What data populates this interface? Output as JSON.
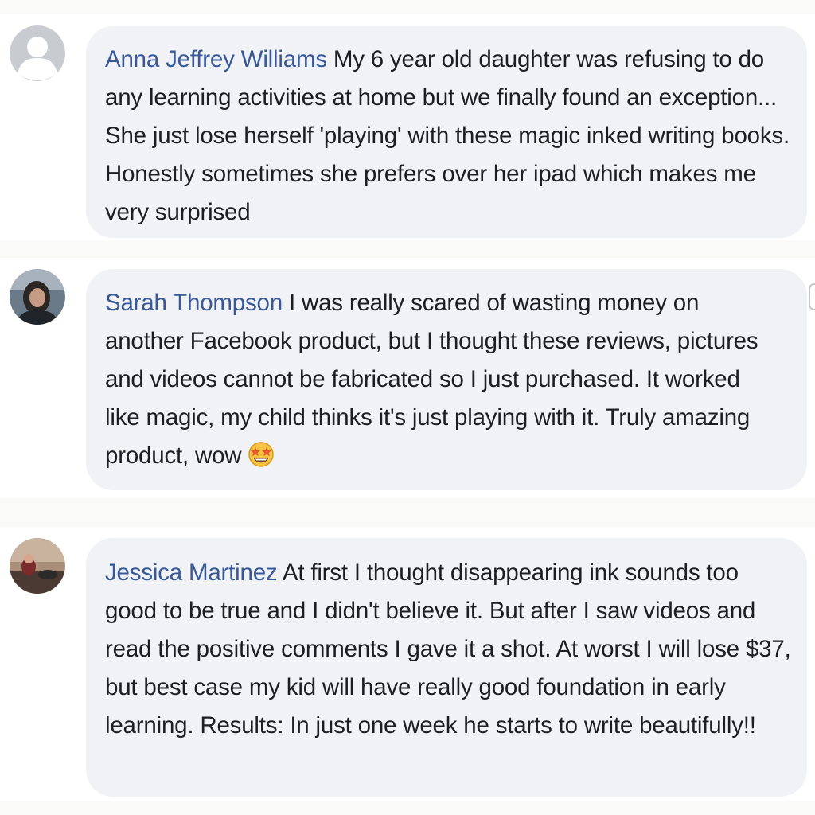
{
  "comments": [
    {
      "author": "Anna Jeffrey Williams",
      "text": "My 6 year old daughter was refusing to do any learning activities at home but we finally found an exception... She just lose herself 'playing' with these magic inked writing books. Honestly sometimes she prefers over her ipad which makes me very surprised",
      "avatar": "default-profile-avatar"
    },
    {
      "author": "Sarah Thompson",
      "text": "I was really scared of wasting money on another Facebook product, but I thought these reviews, pictures and videos cannot be fabricated so I just purchased. It worked like magic, my child thinks it's just playing with it. Truly amazing product, wow",
      "emoji": "star-struck-emoji",
      "avatar": "profile-photo-avatar"
    },
    {
      "author": "Jessica Martinez",
      "text": "At first I thought disappearing ink sounds too good to be true and I didn't believe it. But after I saw videos and read the positive comments I gave it a shot. At worst I will lose $37, but best case my kid will have really good foundation in early learning. Results: In just one week he starts to write beautifully!!",
      "avatar": "profile-photo-avatar"
    }
  ],
  "colors": {
    "author_name": "#385898",
    "bubble_background": "#f0f2f5",
    "body_text": "#1c1e21"
  }
}
